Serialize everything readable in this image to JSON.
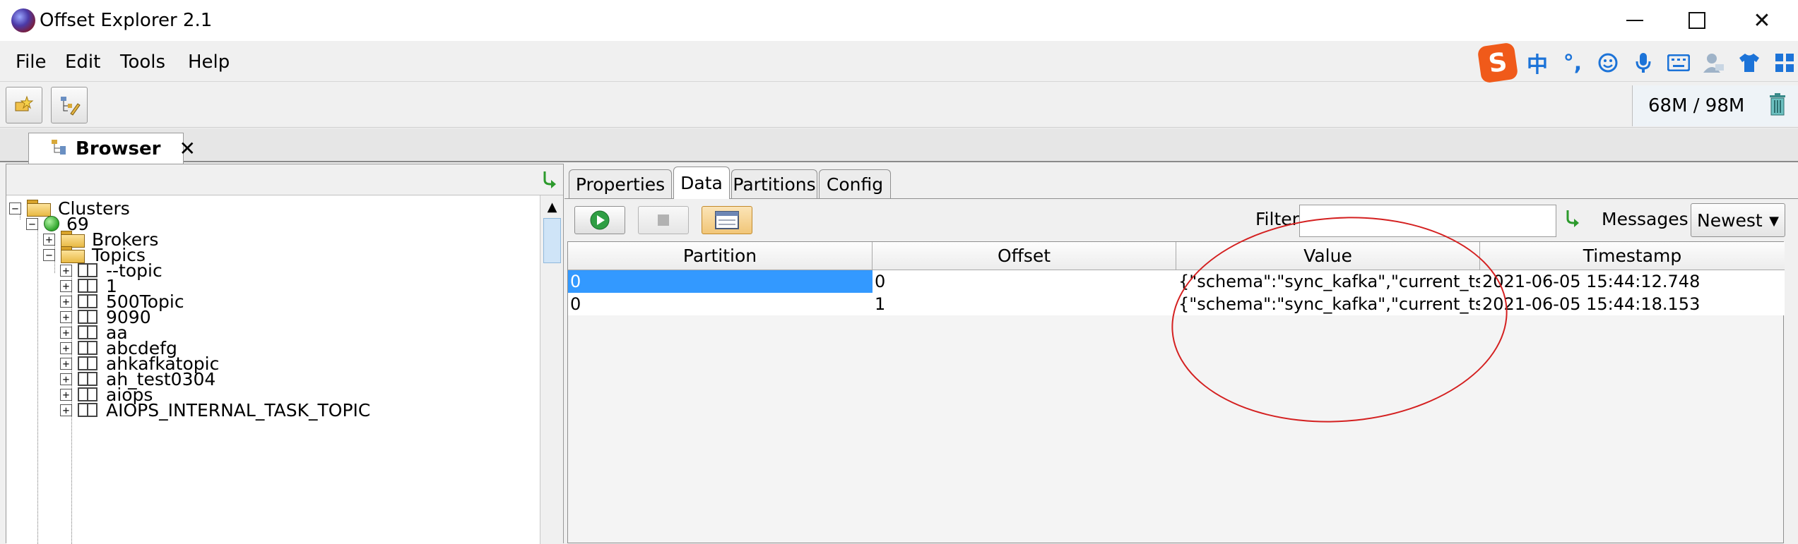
{
  "window": {
    "title": "Offset Explorer  2.1"
  },
  "menu": {
    "file": "File",
    "edit": "Edit",
    "tools": "Tools",
    "help": "Help"
  },
  "ime": {
    "logo": "S",
    "lang": "中",
    "punct": "°,"
  },
  "memory": {
    "text": "68M / 98M"
  },
  "browser_tab": {
    "label": "Browser",
    "close": "✕"
  },
  "tree": {
    "root": "Clusters",
    "cluster": "69",
    "brokers": "Brokers",
    "topics": "Topics",
    "topic_items": [
      "--topic",
      "1",
      "500Topic",
      "9090",
      "aa",
      "abcdefg",
      "ahkafkatopic",
      "ah_test0304",
      "aiops",
      "AIOPS_INTERNAL_TASK_TOPIC"
    ]
  },
  "detail_tabs": [
    "Properties",
    "Data",
    "Partitions",
    "Config"
  ],
  "active_tab": "Data",
  "filter": {
    "label": "Filter",
    "value": ""
  },
  "messages": {
    "label": "Messages",
    "selected": "Newest"
  },
  "table": {
    "columns": [
      "Partition",
      "Offset",
      "Value",
      "Timestamp"
    ],
    "rows": [
      {
        "partition": "0",
        "offset": "0",
        "value": "{\"schema\":\"sync_kafka\",\"current_ts\":...",
        "timestamp": "2021-06-05 15:44:12.748"
      },
      {
        "partition": "0",
        "offset": "1",
        "value": "{\"schema\":\"sync_kafka\",\"current_ts\":...",
        "timestamp": "2021-06-05 15:44:18.153"
      }
    ]
  },
  "colors": {
    "selection": "#3399ff",
    "annotation_circle": "#d42020"
  }
}
